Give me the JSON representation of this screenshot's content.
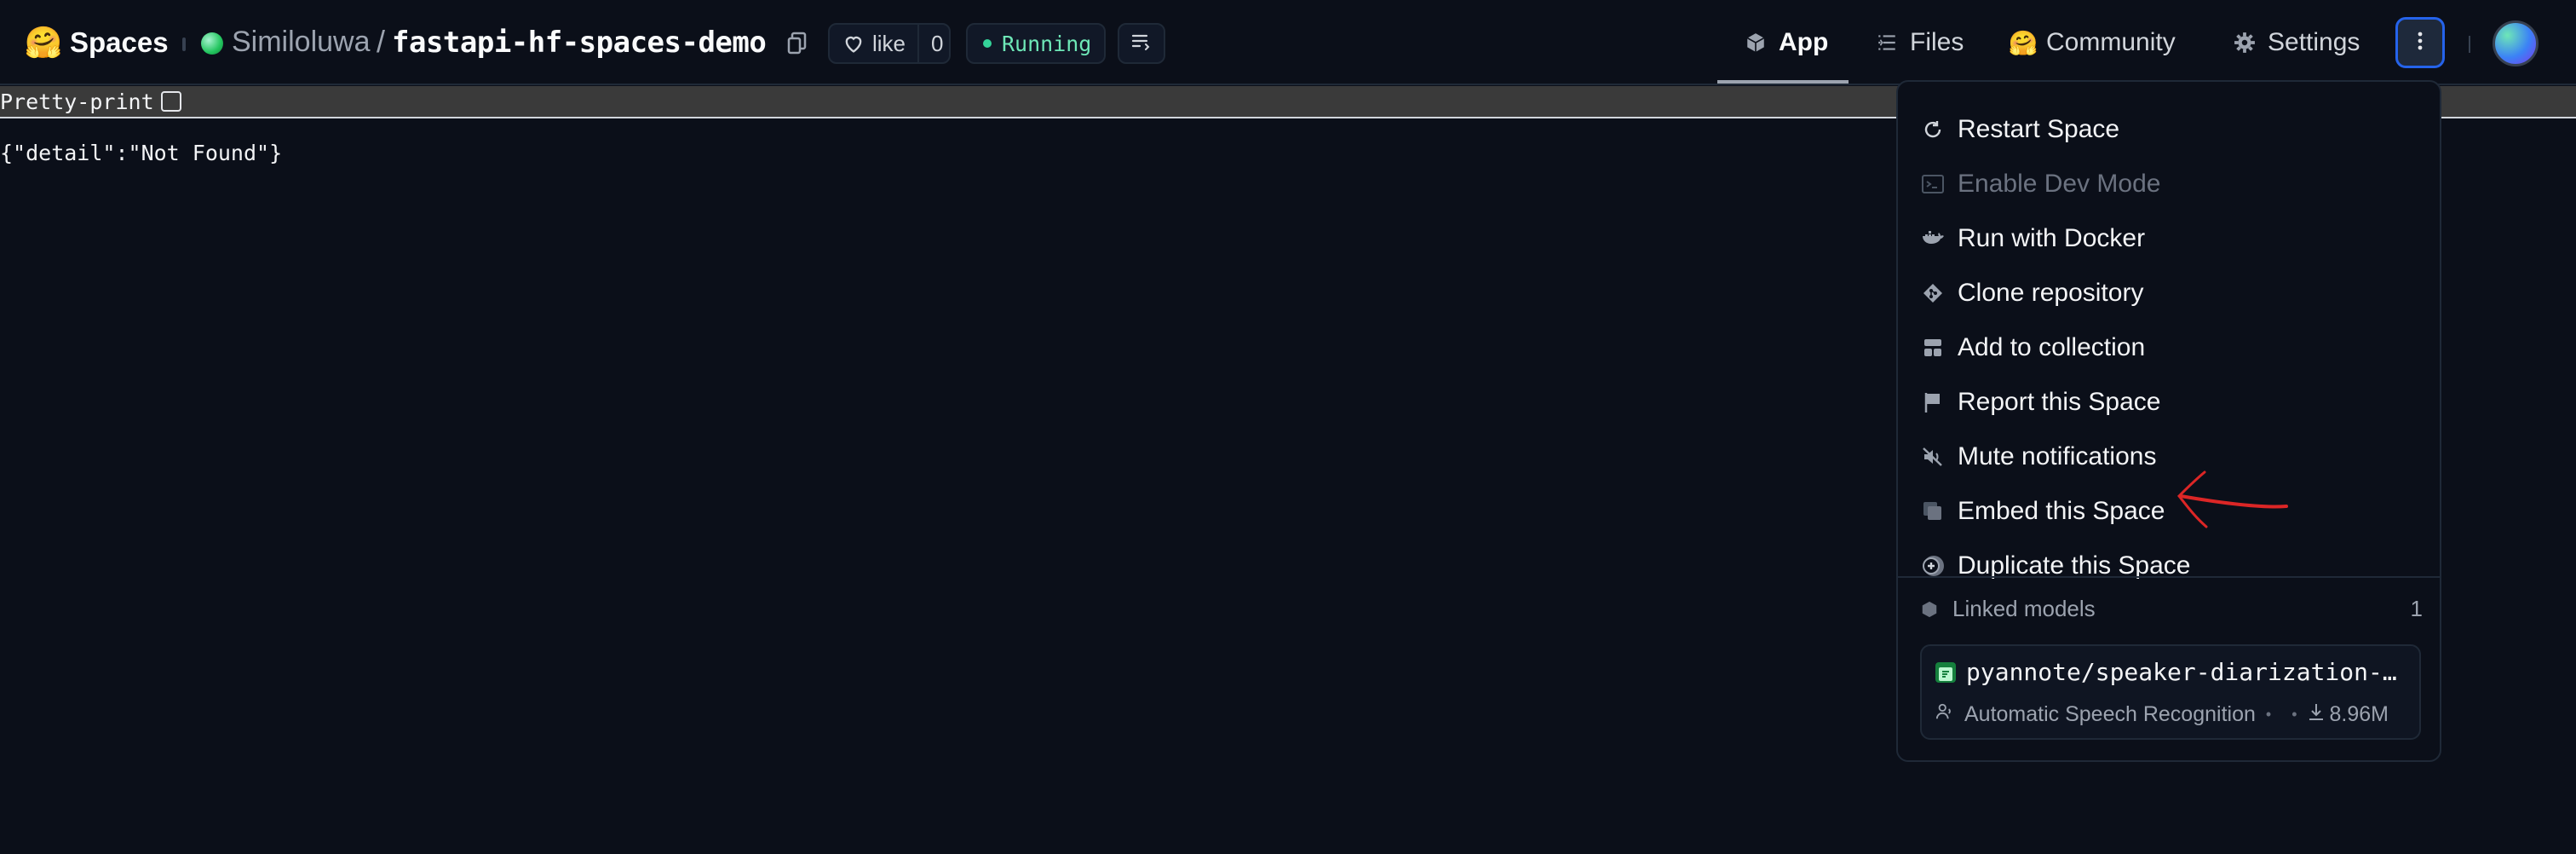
{
  "header": {
    "brand_emoji": "🤗",
    "brand_title": "Spaces",
    "owner": "Similoluwa",
    "slash": "/",
    "repo": "fastapi-hf-spaces-demo",
    "like_label": "like",
    "like_count": "0",
    "status": "Running",
    "status_color": "#34d399"
  },
  "nav": {
    "tabs": [
      {
        "label": "App",
        "icon": "cube-icon",
        "active": true
      },
      {
        "label": "Files",
        "icon": "files-icon"
      },
      {
        "label": "Community",
        "icon": "community-emoji-icon"
      },
      {
        "label": "Settings",
        "icon": "gear-icon"
      }
    ]
  },
  "content": {
    "pretty_print_label": "Pretty-print",
    "json_text": "{\"detail\":\"Not Found\"}"
  },
  "menu": {
    "items": [
      {
        "label": "Restart Space",
        "icon": "restart-icon"
      },
      {
        "label": "Enable Dev Mode",
        "icon": "terminal-icon",
        "disabled": true
      },
      {
        "label": "Run with Docker",
        "icon": "docker-icon"
      },
      {
        "label": "Clone repository",
        "icon": "git-icon"
      },
      {
        "label": "Add to collection",
        "icon": "collection-icon"
      },
      {
        "label": "Report this Space",
        "icon": "flag-icon"
      },
      {
        "label": "Mute notifications",
        "icon": "mute-icon"
      },
      {
        "label": "Embed this Space",
        "icon": "embed-icon"
      },
      {
        "label": "Duplicate this Space",
        "icon": "duplicate-icon"
      }
    ],
    "linked_models_label": "Linked models",
    "linked_models_count": "1",
    "model": {
      "name": "pyannote/speaker-diarization-…",
      "task": "Automatic Speech Recognition",
      "downloads": "8.96M"
    }
  },
  "colors": {
    "background": "#0b0f19",
    "accent_blue": "#2563eb",
    "annotation_red": "#dc2626"
  }
}
